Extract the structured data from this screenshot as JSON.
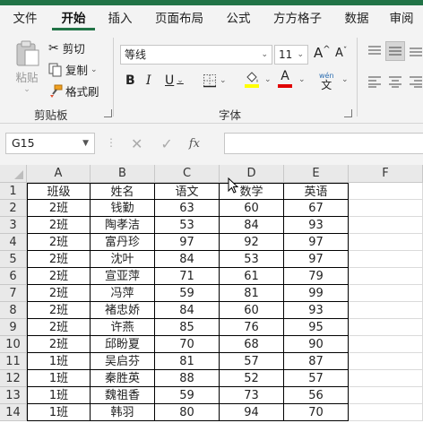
{
  "tabs": [
    "文件",
    "开始",
    "插入",
    "页面布局",
    "公式",
    "方方格子",
    "数据",
    "审阅"
  ],
  "active_tab": "开始",
  "ribbon": {
    "clipboard": {
      "paste": "粘贴",
      "cut": "剪切",
      "copy": "复制",
      "format_painter": "格式刷",
      "label": "剪贴板"
    },
    "font": {
      "font_name": "等线",
      "font_size": "11",
      "bold": "B",
      "italic": "I",
      "underline": "U",
      "grow": "A",
      "shrink": "A",
      "phonetic_top": "wén",
      "phonetic_bottom": "文",
      "label": "字体",
      "fill_color": "#ffff00",
      "font_color": "#e00000"
    }
  },
  "formula_bar": {
    "name_box": "G15",
    "fx": "fx",
    "formula": ""
  },
  "columns": [
    "A",
    "B",
    "C",
    "D",
    "E",
    "F"
  ],
  "rows": [
    [
      "班级",
      "姓名",
      "语文",
      "数学",
      "英语"
    ],
    [
      "2班",
      "钱勤",
      "63",
      "60",
      "67"
    ],
    [
      "2班",
      "陶孝洁",
      "53",
      "84",
      "93"
    ],
    [
      "2班",
      "富丹珍",
      "97",
      "92",
      "97"
    ],
    [
      "2班",
      "沈叶",
      "84",
      "53",
      "97"
    ],
    [
      "2班",
      "宣亚萍",
      "71",
      "61",
      "79"
    ],
    [
      "2班",
      "冯萍",
      "59",
      "81",
      "99"
    ],
    [
      "2班",
      "褚忠娇",
      "84",
      "60",
      "93"
    ],
    [
      "2班",
      "许燕",
      "85",
      "76",
      "95"
    ],
    [
      "2班",
      "邱盼夏",
      "70",
      "68",
      "90"
    ],
    [
      "1班",
      "吴启芬",
      "81",
      "57",
      "87"
    ],
    [
      "1班",
      "秦胜英",
      "88",
      "52",
      "57"
    ],
    [
      "1班",
      "魏祖香",
      "59",
      "73",
      "56"
    ],
    [
      "1班",
      "韩羽",
      "80",
      "94",
      "70"
    ]
  ]
}
